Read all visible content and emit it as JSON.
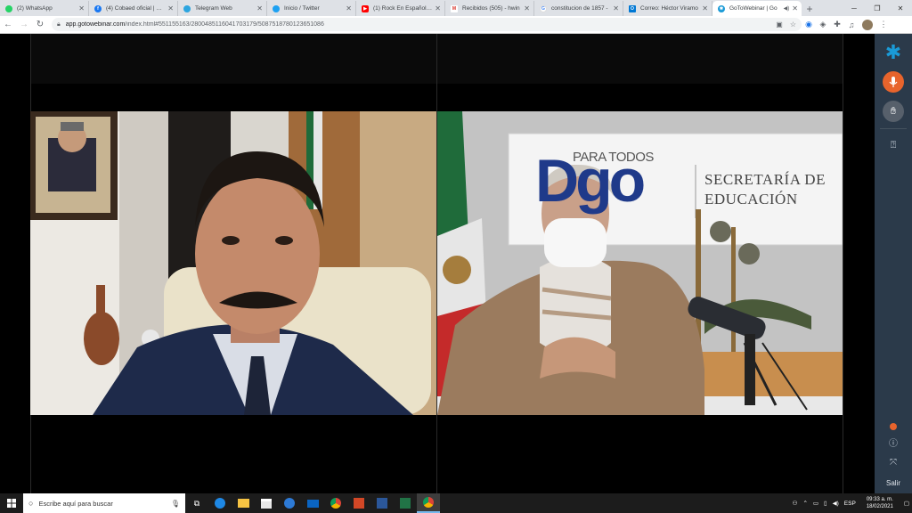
{
  "browser": {
    "tabs": [
      {
        "title": "(2) WhatsApp",
        "color": "#25d366",
        "glyph": "W"
      },
      {
        "title": "(4) Cobaed oficial | Face",
        "color": "#1877f2",
        "glyph": "f"
      },
      {
        "title": "Telegram Web",
        "color": "#2ca5e0",
        "glyph": "✈"
      },
      {
        "title": "Inicio / Twitter",
        "color": "#1da1f2",
        "glyph": "t"
      },
      {
        "title": "(1) Rock En Español En",
        "color": "#ff0000",
        "glyph": "▶"
      },
      {
        "title": "Recibidos (505) - hwin",
        "color": "#d93025",
        "glyph": "M"
      },
      {
        "title": "constitucion de 1857 -",
        "color": "#4285f4",
        "glyph": "G"
      },
      {
        "title": "Correo: Héctor Viramo",
        "color": "#0078d4",
        "glyph": "O"
      },
      {
        "title": "GoToWebinar | Go",
        "color": "#1a9ad6",
        "glyph": "✱"
      }
    ],
    "url_host": "app.gotowebinar.com",
    "url_path": "/index.html#551155163/2800485116041703179/5087518780123651086"
  },
  "panel": {
    "exit_label": "Salir"
  },
  "video_right": {
    "banner_para": "PARA TODOS",
    "banner_logo": "Dgo",
    "banner_sec1": "SECRETARÍA DE",
    "banner_sec2": "EDUCACIÓN"
  },
  "taskbar": {
    "search_placeholder": "Escribe aquí para buscar",
    "lang": "ESP",
    "time": "09:33 a. m.",
    "date": "18/02/2021"
  },
  "colors": {
    "accent_orange": "#e8642c",
    "panel_bg": "#2b3a4a",
    "logo_blue": "#1a9ad6"
  }
}
